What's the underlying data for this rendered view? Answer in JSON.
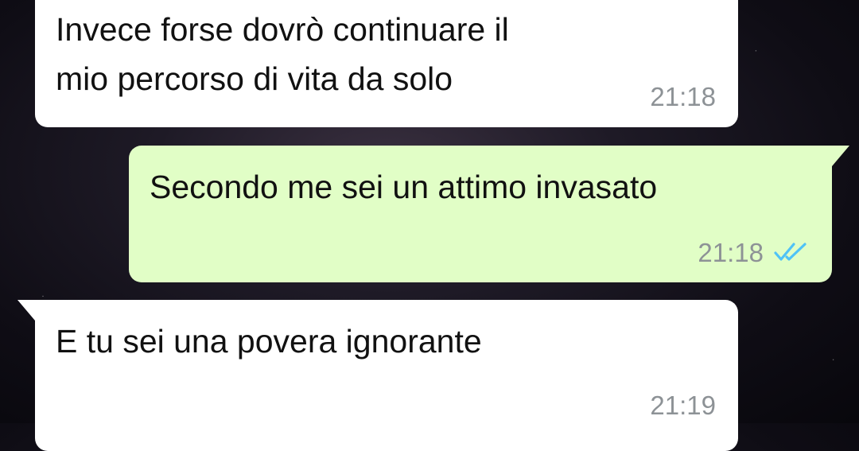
{
  "messages": [
    {
      "direction": "incoming",
      "lines": [
        "Invece forse dovrò continuare il",
        "mio percorso di vita da solo"
      ],
      "time": "21:18"
    },
    {
      "direction": "outgoing",
      "text": "Secondo me sei un attimo invasato",
      "time": "21:18",
      "status_icon": "double-check-read-icon"
    },
    {
      "direction": "incoming",
      "text": "E tu sei una povera ignorante",
      "time": "21:19"
    }
  ],
  "colors": {
    "incoming_bubble": "#ffffff",
    "outgoing_bubble": "#e1fec6",
    "timestamp": "#8d9296",
    "read_ticks": "#4fc3f7"
  }
}
